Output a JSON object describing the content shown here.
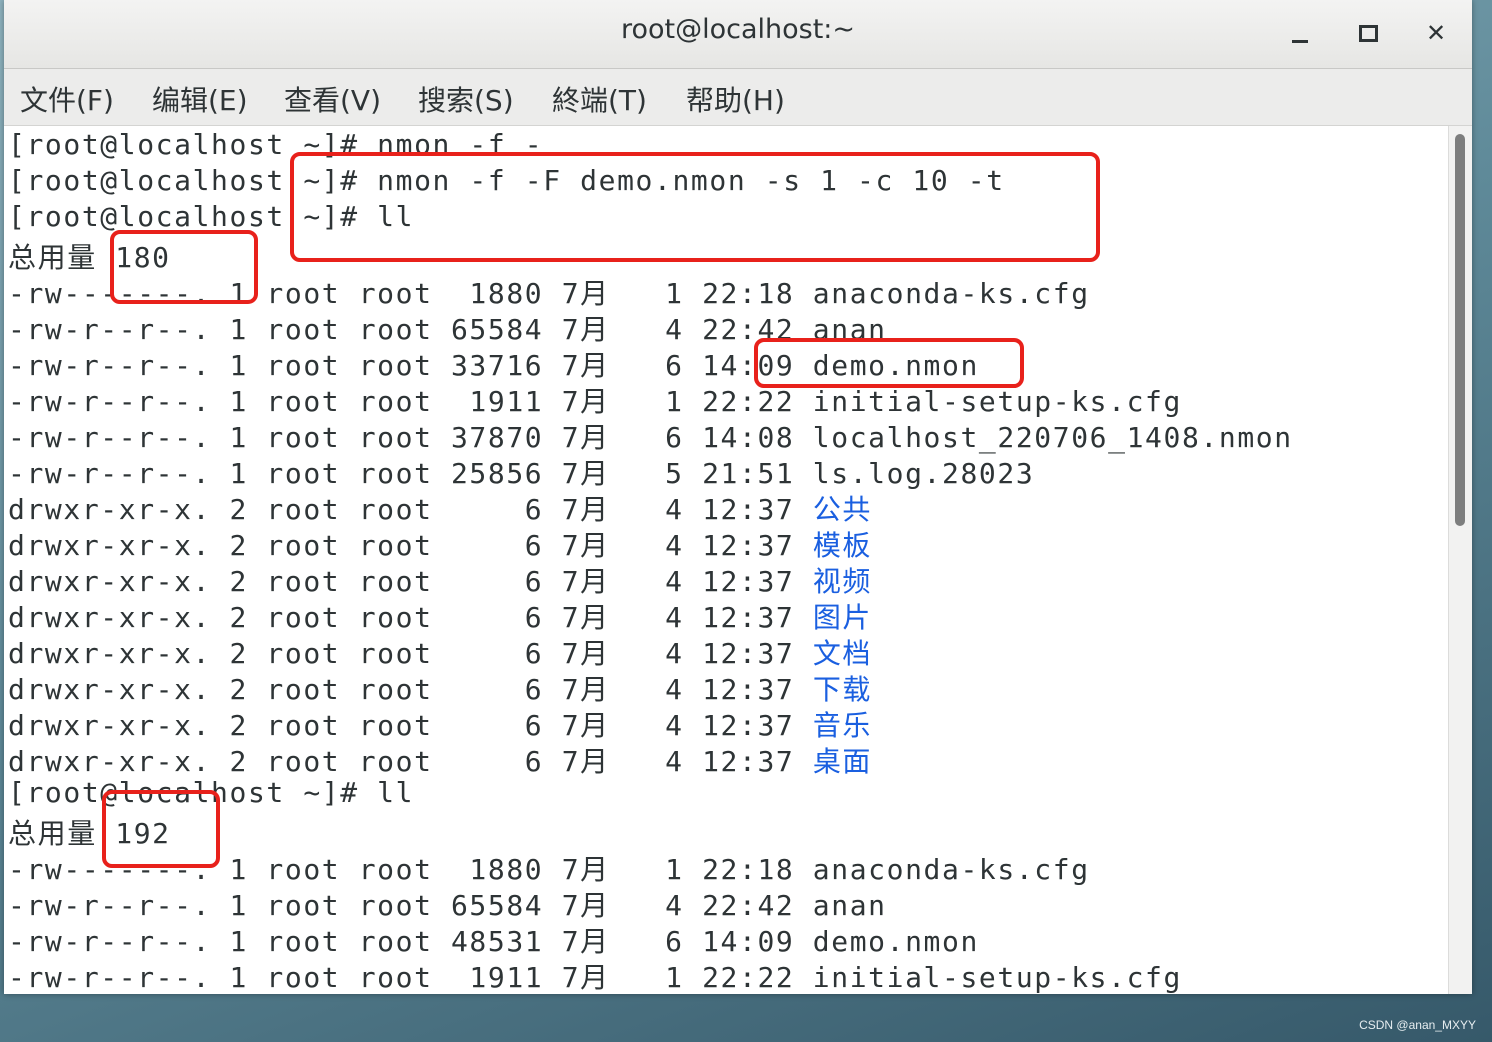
{
  "window": {
    "title": "root@localhost:~"
  },
  "menu": [
    "文件(F)",
    "编辑(E)",
    "查看(V)",
    "搜索(S)",
    "終端(T)",
    "帮助(H)"
  ],
  "terminal": {
    "lines": [
      {
        "text": "[root@localhost ~]# nmon -f -"
      },
      {
        "text": "[root@localhost ~]# nmon -f -F demo.nmon -s 1 -c 10 -t"
      },
      {
        "text": "[root@localhost ~]# ll"
      },
      {
        "text": "总用量 180"
      },
      {
        "text": "-rw-------. 1 root root  1880 7月   1 22:18 anaconda-ks.cfg"
      },
      {
        "text": "-rw-r--r--. 1 root root 65584 7月   4 22:42 anan"
      },
      {
        "text": "-rw-r--r--. 1 root root 33716 7月   6 14:09 demo.nmon"
      },
      {
        "text": "-rw-r--r--. 1 root root  1911 7月   1 22:22 initial-setup-ks.cfg"
      },
      {
        "text": "-rw-r--r--. 1 root root 37870 7月   6 14:08 localhost_220706_1408.nmon"
      },
      {
        "text": "-rw-r--r--. 1 root root 25856 7月   5 21:51 ls.log.28023"
      },
      {
        "text": "drwxr-xr-x. 2 root root     6 7月   4 12:37 ",
        "dir": "公共"
      },
      {
        "text": "drwxr-xr-x. 2 root root     6 7月   4 12:37 ",
        "dir": "模板"
      },
      {
        "text": "drwxr-xr-x. 2 root root     6 7月   4 12:37 ",
        "dir": "视频"
      },
      {
        "text": "drwxr-xr-x. 2 root root     6 7月   4 12:37 ",
        "dir": "图片"
      },
      {
        "text": "drwxr-xr-x. 2 root root     6 7月   4 12:37 ",
        "dir": "文档"
      },
      {
        "text": "drwxr-xr-x. 2 root root     6 7月   4 12:37 ",
        "dir": "下载"
      },
      {
        "text": "drwxr-xr-x. 2 root root     6 7月   4 12:37 ",
        "dir": "音乐"
      },
      {
        "text": "drwxr-xr-x. 2 root root     6 7月   4 12:37 ",
        "dir": "桌面"
      },
      {
        "text": "[root@localhost ~]# ll"
      },
      {
        "text": "总用量 192"
      },
      {
        "text": "-rw-------. 1 root root  1880 7月   1 22:18 anaconda-ks.cfg"
      },
      {
        "text": "-rw-r--r--. 1 root root 65584 7月   4 22:42 anan"
      },
      {
        "text": "-rw-r--r--. 1 root root 48531 7月   6 14:09 demo.nmon"
      },
      {
        "text": "-rw-r--r--. 1 root root  1911 7月   1 22:22 initial-setup-ks.cfg"
      }
    ]
  },
  "watermark": "CSDN @anan_MXYY",
  "colors": {
    "annotation": "#e8211b",
    "directory": "#1a5fe0",
    "text": "#2e3436"
  }
}
